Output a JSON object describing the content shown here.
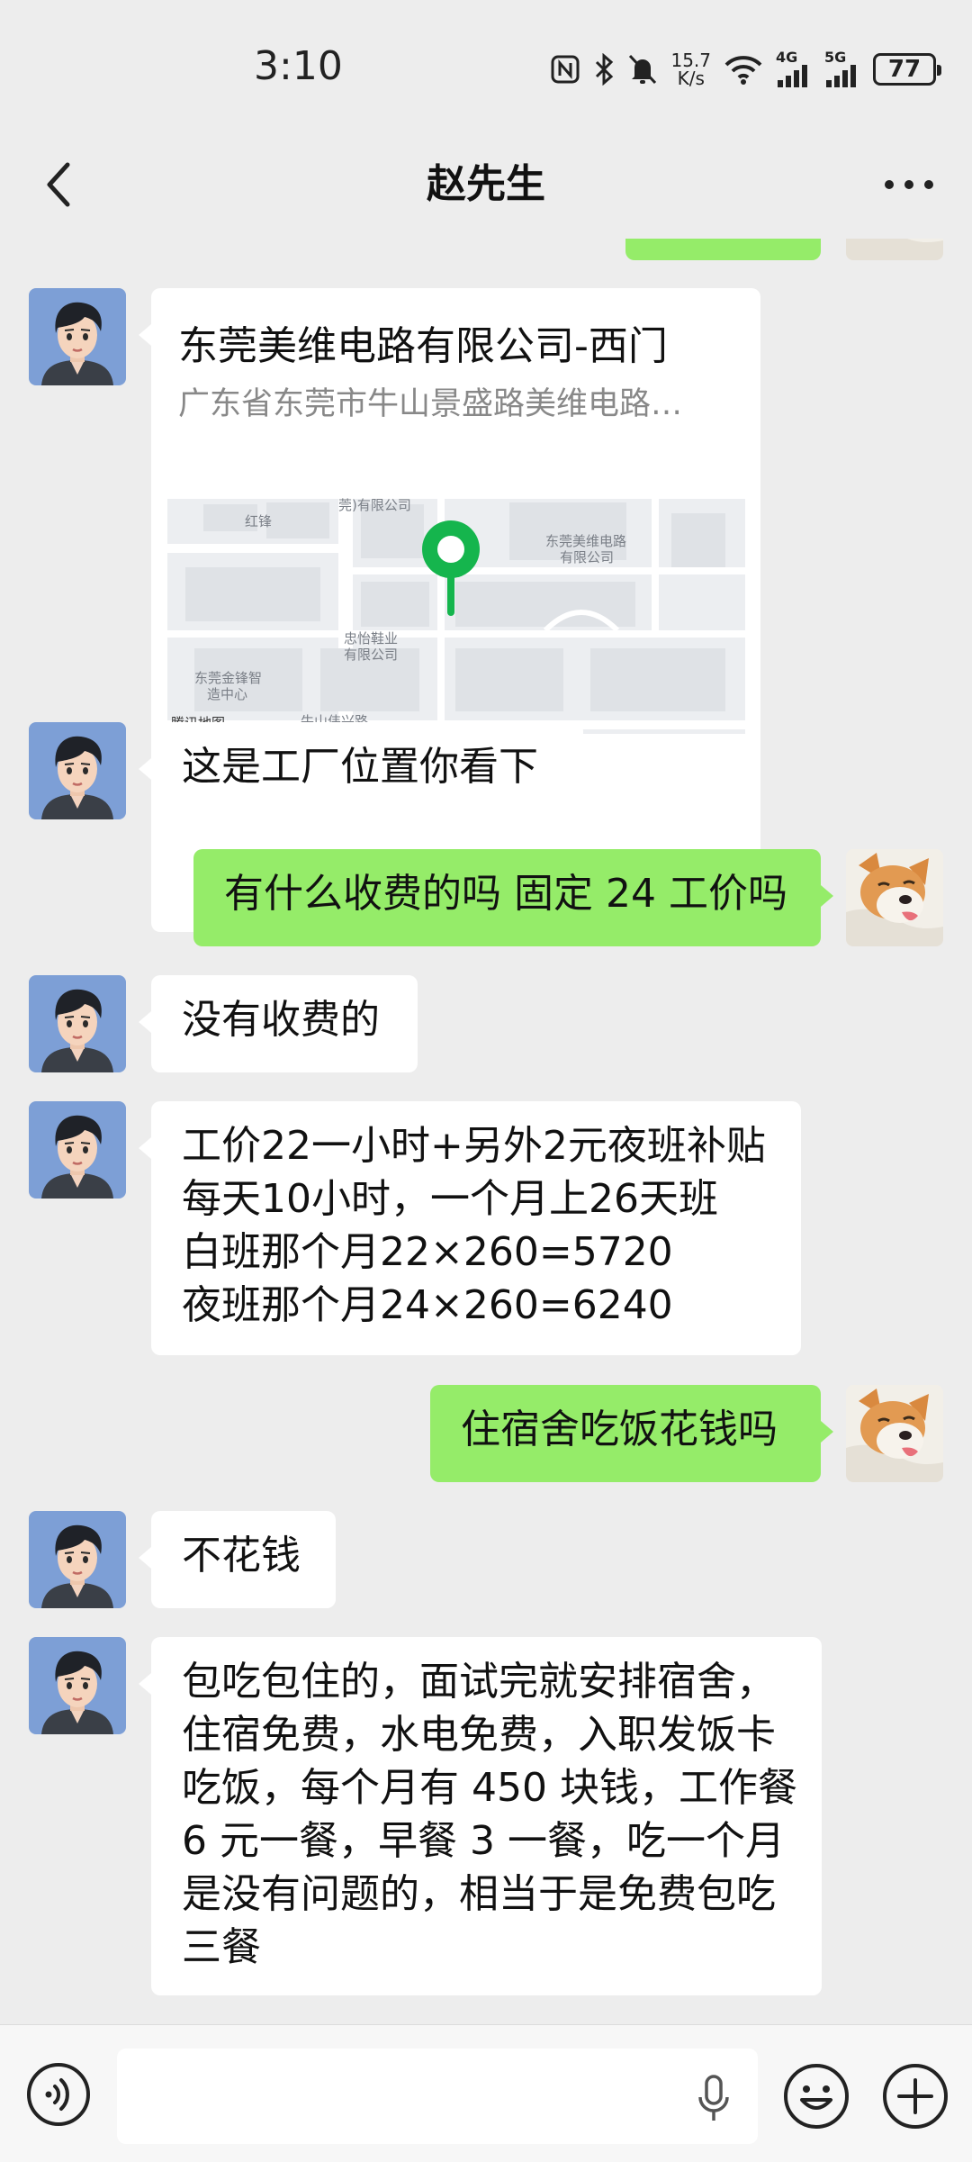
{
  "status_bar": {
    "time": "3:10",
    "net_speed_value": "15.7",
    "net_speed_unit": "K/s",
    "signal_1_label": "4G",
    "signal_2_label": "5G",
    "battery": "77",
    "icons": [
      "nfc-icon",
      "bluetooth-icon",
      "mute-icon",
      "wifi-icon",
      "signal-icon",
      "signal-icon",
      "battery-icon"
    ]
  },
  "header": {
    "title": "赵先生",
    "back_icon": "chevron-left-icon",
    "more_icon": "more-dots-icon"
  },
  "location": {
    "name": "东莞美维电路有限公司-西门",
    "address": "广东省东莞市牛山景盛路美维电路…",
    "map_labels": {
      "top_company": "莞)有限公司",
      "hongfeng": "红锋",
      "meiwei": "东莞美维电路",
      "meiwei2": "有限公司",
      "zhongyi": "忠怡鞋业",
      "zhongyi2": "有限公司",
      "jinfeng": "东莞金锋智",
      "jinfeng2": "造中心",
      "road": "牛山伟兴路",
      "brand": "腾讯地图"
    },
    "pin_color": "#15b54d"
  },
  "messages": [
    {
      "side": "in",
      "lines": [
        "这是工厂位置你看下"
      ]
    },
    {
      "side": "out",
      "lines": [
        "有什么收费的吗 固定 24 工价吗"
      ]
    },
    {
      "side": "in",
      "lines": [
        "没有收费的"
      ]
    },
    {
      "side": "in",
      "lines": [
        "工价22一小时+另外2元夜班补贴",
        "每天10小时，一个月上26天班",
        "白班那个月22×260=5720",
        "夜班那个月24×260=6240"
      ]
    },
    {
      "side": "out",
      "lines": [
        "住宿舍吃饭花钱吗"
      ]
    },
    {
      "side": "in",
      "lines": [
        "不花钱"
      ]
    },
    {
      "side": "in",
      "lines": [
        "包吃包住的，面试完就安排宿舍，",
        "住宿免费，水电免费，入职发饭卡",
        "吃饭，每个月有 450 块钱，工作餐",
        "6 元一餐，早餐 3 一餐，吃一个月",
        "是没有问题的，相当于是免费包吃",
        "三餐"
      ]
    }
  ],
  "input_bar": {
    "placeholder": "",
    "voice_icon": "voice-icon",
    "mic_icon": "microphone-icon",
    "emoji_icon": "emoji-icon",
    "plus_icon": "plus-icon"
  },
  "colors": {
    "background": "#ededed",
    "incoming_bubble": "#ffffff",
    "outgoing_bubble": "#95ec69",
    "avatar_bg": "#7d9fd6"
  }
}
